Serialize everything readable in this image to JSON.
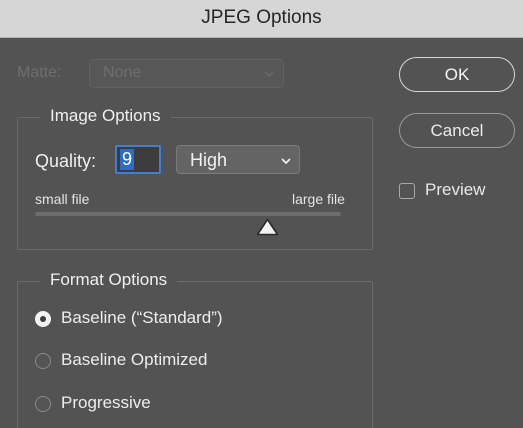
{
  "dialog": {
    "title": "JPEG Options"
  },
  "matte": {
    "label": "Matte:",
    "value": "None",
    "enabled": false
  },
  "image_options": {
    "title": "Image Options",
    "quality_label": "Quality:",
    "quality_value": "9",
    "quality_preset": "High",
    "slider_min_label": "small file",
    "slider_max_label": "large file",
    "slider_value_fraction": 0.75
  },
  "format_options": {
    "title": "Format Options",
    "options": [
      {
        "label": "Baseline (“Standard”)",
        "selected": true
      },
      {
        "label": "Baseline Optimized",
        "selected": false
      },
      {
        "label": "Progressive",
        "selected": false
      }
    ]
  },
  "buttons": {
    "ok": "OK",
    "cancel": "Cancel"
  },
  "preview": {
    "label": "Preview",
    "checked": false
  },
  "icons": {
    "dropdown": "chevron-down-icon",
    "slider_thumb": "triangle-thumb-icon"
  },
  "colors": {
    "background": "#535353",
    "focus_ring": "#3d80d6",
    "selection": "#2e6cc6"
  }
}
